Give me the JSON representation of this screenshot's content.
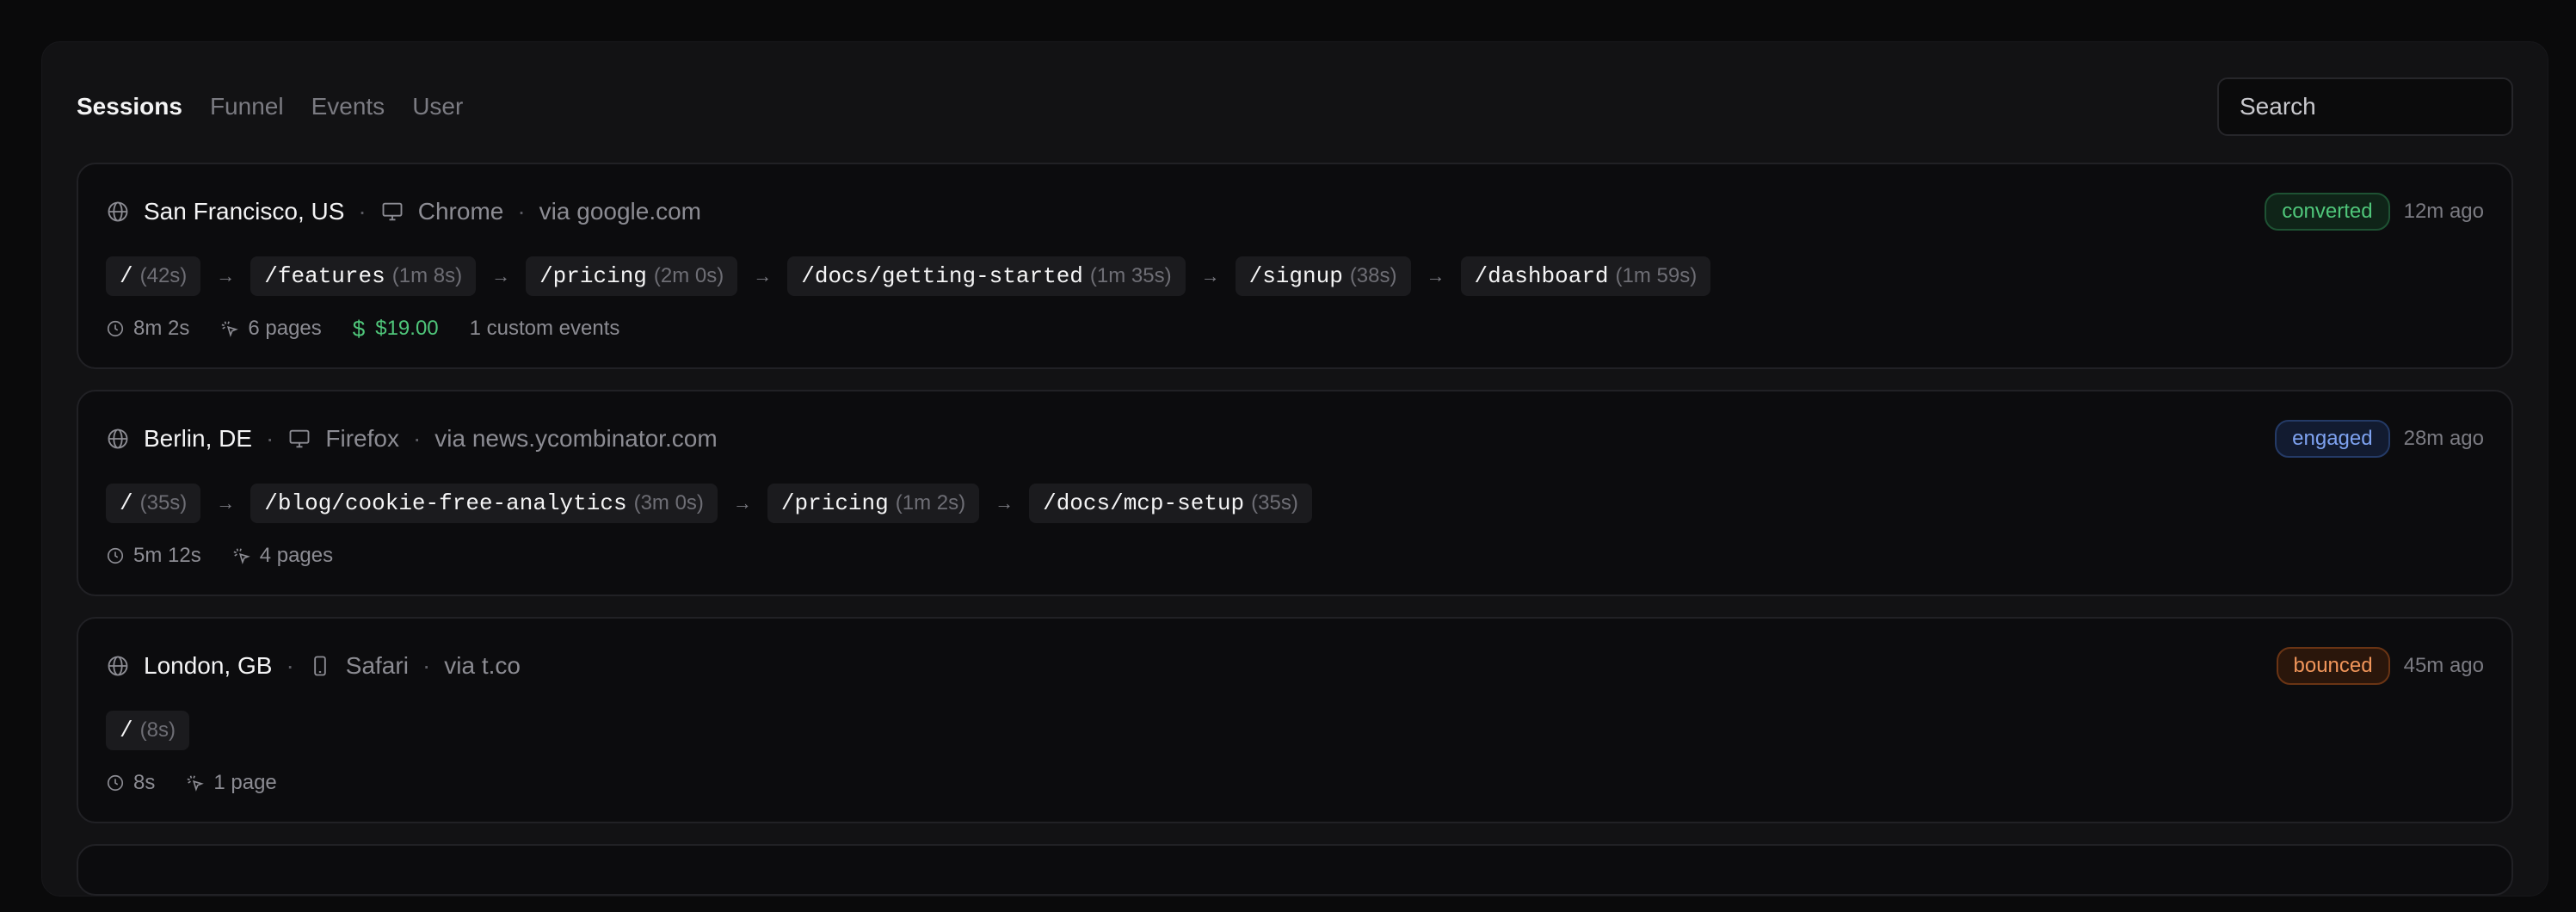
{
  "tabs": [
    {
      "label": "Sessions",
      "active": true
    },
    {
      "label": "Funnel",
      "active": false
    },
    {
      "label": "Events",
      "active": false
    },
    {
      "label": "User",
      "active": false
    }
  ],
  "search": {
    "placeholder": "Search"
  },
  "sessions": [
    {
      "location": "San Francisco, US",
      "device_icon": "desktop-icon",
      "browser": "Chrome",
      "referrer": "via google.com",
      "status": "converted",
      "ago": "12m ago",
      "path": [
        {
          "path": "/",
          "duration": "(42s)"
        },
        {
          "path": "/features",
          "duration": "(1m 8s)"
        },
        {
          "path": "/pricing",
          "duration": "(2m 0s)"
        },
        {
          "path": "/docs/getting-started",
          "duration": "(1m 35s)"
        },
        {
          "path": "/signup",
          "duration": "(38s)"
        },
        {
          "path": "/dashboard",
          "duration": "(1m 59s)"
        }
      ],
      "duration": "8m 2s",
      "pages": "6 pages",
      "revenue": "$19.00",
      "custom_events": "1 custom events"
    },
    {
      "location": "Berlin, DE",
      "device_icon": "desktop-icon",
      "browser": "Firefox",
      "referrer": "via news.ycombinator.com",
      "status": "engaged",
      "ago": "28m ago",
      "path": [
        {
          "path": "/",
          "duration": "(35s)"
        },
        {
          "path": "/blog/cookie-free-analytics",
          "duration": "(3m 0s)"
        },
        {
          "path": "/pricing",
          "duration": "(1m 2s)"
        },
        {
          "path": "/docs/mcp-setup",
          "duration": "(35s)"
        }
      ],
      "duration": "5m 12s",
      "pages": "4 pages"
    },
    {
      "location": "London, GB",
      "device_icon": "mobile-icon",
      "browser": "Safari",
      "referrer": "via t.co",
      "status": "bounced",
      "ago": "45m ago",
      "path": [
        {
          "path": "/",
          "duration": "(8s)"
        }
      ],
      "duration": "8s",
      "pages": "1 page"
    }
  ]
}
